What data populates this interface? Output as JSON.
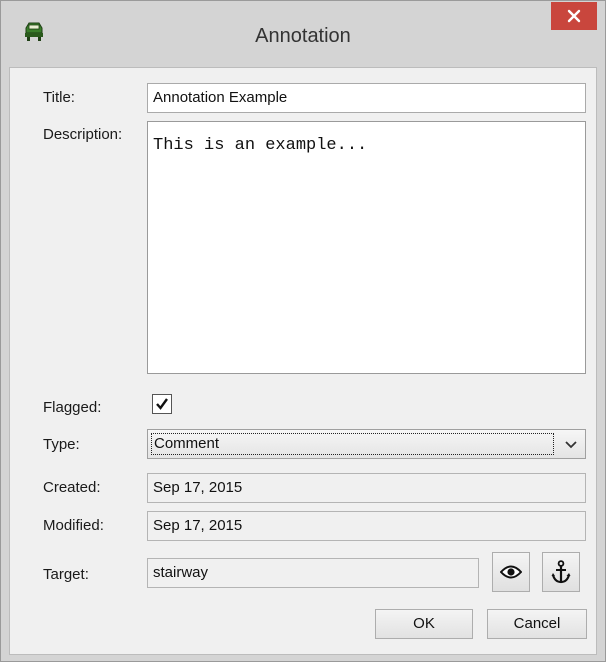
{
  "window": {
    "title": "Annotation"
  },
  "form": {
    "title_label": "Title:",
    "title_value": "Annotation Example",
    "description_label": "Description:",
    "description_value": "This is an example...",
    "flagged_label": "Flagged:",
    "flagged": true,
    "type_label": "Type:",
    "type_value": "Comment",
    "created_label": "Created:",
    "created_value": "Sep 17, 2015",
    "modified_label": "Modified:",
    "modified_value": "Sep 17, 2015",
    "target_label": "Target:",
    "target_value": "stairway"
  },
  "icons": {
    "app": "annotation-app-icon",
    "close": "close-icon",
    "view": "eye-icon",
    "anchor": "anchor-icon",
    "dropdown": "chevron-down-icon",
    "check": "checkmark-icon"
  },
  "buttons": {
    "ok": "OK",
    "cancel": "Cancel"
  },
  "colors": {
    "close_button": "#c9463d",
    "dialog_bg": "#f0f0f0",
    "frame": "#d4d4d4"
  }
}
